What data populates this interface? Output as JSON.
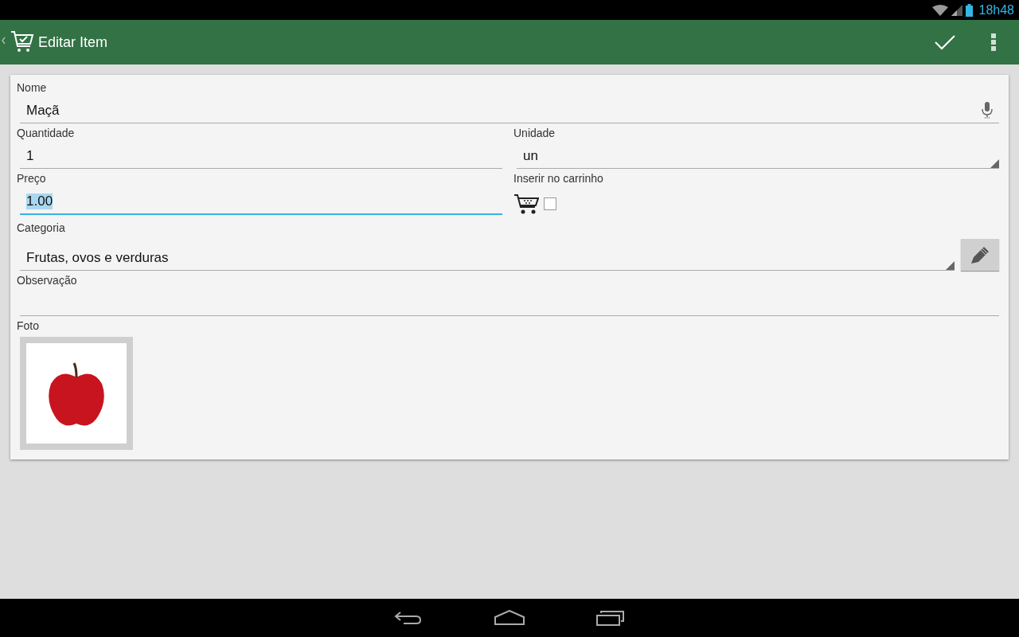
{
  "status_bar": {
    "time": "18h48"
  },
  "action_bar": {
    "title": "Editar Item"
  },
  "form": {
    "rows": [
      [
        {
          "kind": "voice_text",
          "label": "Nome",
          "value": "Maçã",
          "focused": false
        }
      ],
      [
        {
          "kind": "text",
          "label": "Quantidade",
          "value": "1",
          "focused": false
        },
        {
          "kind": "spinner",
          "label": "Unidade",
          "value": "un"
        }
      ],
      [
        {
          "kind": "text",
          "label": "Preço",
          "value": "1.00",
          "focused": true
        },
        {
          "kind": "cart_checkbox",
          "label": "Inserir no carrinho",
          "checked": false
        }
      ],
      [
        {
          "kind": "spinner_edit",
          "label": "Categoria",
          "value": "Frutas, ovos e verduras"
        }
      ],
      [
        {
          "kind": "text",
          "label": "Observação",
          "focused": false
        }
      ],
      [
        {
          "kind": "photo",
          "label": "Foto"
        }
      ]
    ]
  }
}
